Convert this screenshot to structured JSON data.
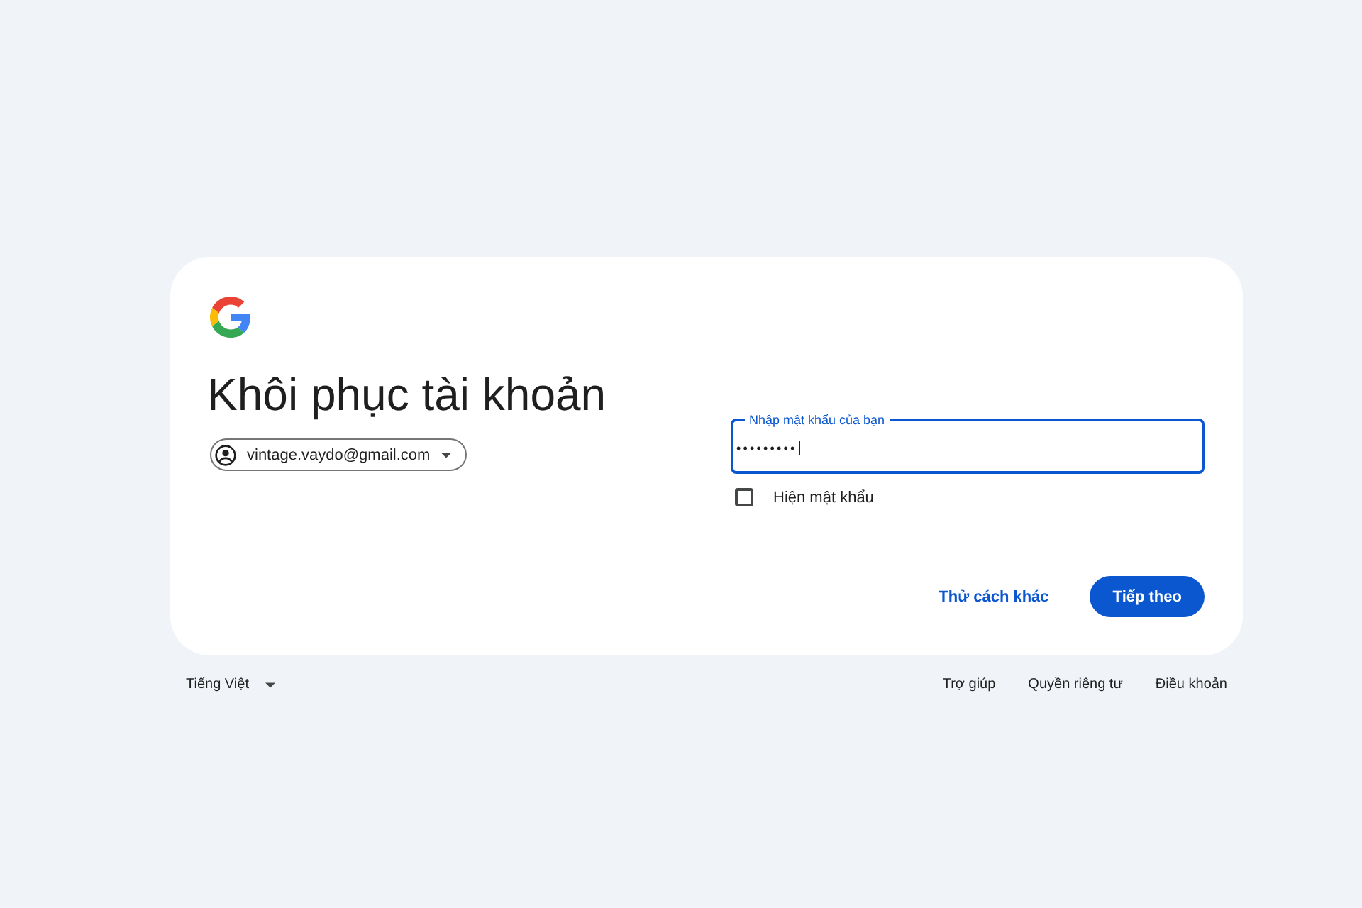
{
  "title": "Khôi phục tài khoản",
  "account_chip": {
    "email": "vintage.vaydo@gmail.com"
  },
  "password_field": {
    "label": "Nhập mật khẩu của bạn",
    "value": "•••••••••",
    "focused": true
  },
  "show_password": {
    "label": "Hiện mật khẩu",
    "checked": false
  },
  "buttons": [
    {
      "label": "Thử cách khác",
      "kind": "text"
    },
    {
      "label": "Tiếp theo",
      "kind": "filled"
    }
  ],
  "footer": {
    "language": "Tiếng Việt",
    "links": [
      "Trợ giúp",
      "Quyền riêng tư",
      "Điều khoản"
    ]
  }
}
